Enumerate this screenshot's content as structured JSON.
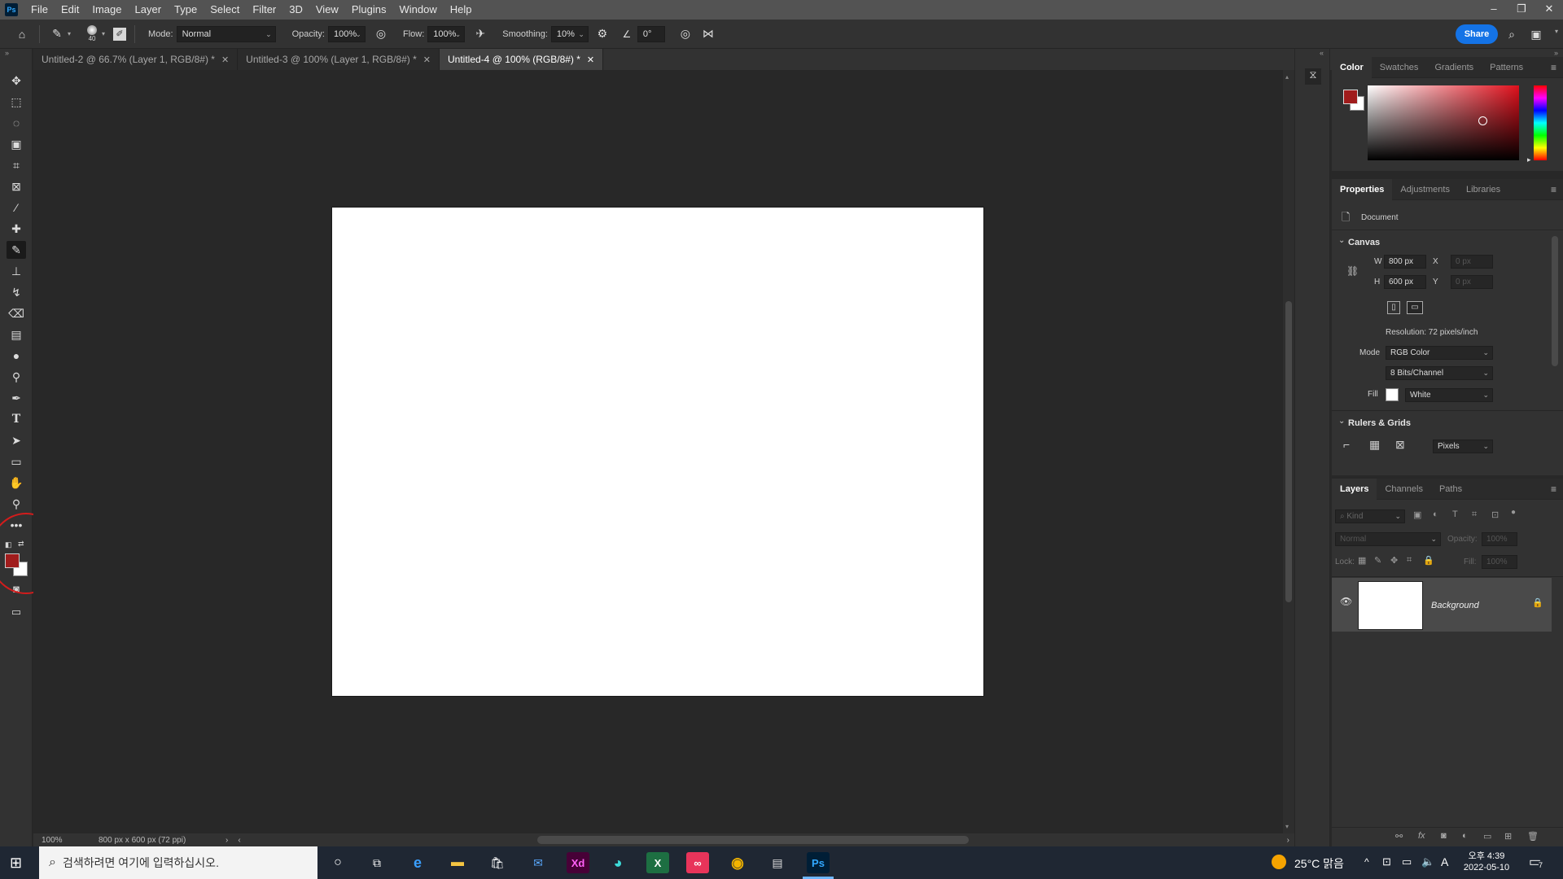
{
  "menubar": {
    "app_icon": "Ps",
    "items": [
      "File",
      "Edit",
      "Image",
      "Layer",
      "Type",
      "Select",
      "Filter",
      "3D",
      "View",
      "Plugins",
      "Window",
      "Help"
    ],
    "window_controls": [
      "–",
      "❐",
      "✕"
    ]
  },
  "options": {
    "brush_size": "40",
    "mode_label": "Mode:",
    "mode_value": "Normal",
    "opacity_label": "Opacity:",
    "opacity_value": "100%",
    "flow_label": "Flow:",
    "flow_value": "100%",
    "smoothing_label": "Smoothing:",
    "smoothing_value": "10%",
    "angle_value": "0°",
    "share_label": "Share"
  },
  "tabs": [
    {
      "label": "Untitled-2 @ 66.7% (Layer 1, RGB/8#) *"
    },
    {
      "label": "Untitled-3 @ 100% (Layer 1, RGB/8#) *"
    },
    {
      "label": "Untitled-4 @ 100% (RGB/8#) *"
    }
  ],
  "status": {
    "zoom": "100%",
    "doc_size": "800 px x 600 px (72 ppi)"
  },
  "color_panel": {
    "tabs": [
      "Color",
      "Swatches",
      "Gradients",
      "Patterns"
    ],
    "foreground": "#a01c1c",
    "background": "#ffffff"
  },
  "properties_panel": {
    "tabs": [
      "Properties",
      "Adjustments",
      "Libraries"
    ],
    "doc_label": "Document",
    "canvas_title": "Canvas",
    "w_label": "W",
    "w_value": "800 px",
    "h_label": "H",
    "h_value": "600 px",
    "x_label": "X",
    "x_value": "0 px",
    "y_label": "Y",
    "y_value": "0 px",
    "resolution": "Resolution: 72 pixels/inch",
    "mode_label": "Mode",
    "mode_value": "RGB Color",
    "bits_value": "8 Bits/Channel",
    "fill_label": "Fill",
    "fill_value": "White",
    "rulers_title": "Rulers & Grids",
    "units_value": "Pixels"
  },
  "layers_panel": {
    "tabs": [
      "Layers",
      "Channels",
      "Paths"
    ],
    "kind_placeholder": "Kind",
    "blend_mode": "Normal",
    "opacity_label": "Opacity:",
    "opacity_value": "100%",
    "lock_label": "Lock:",
    "fill_label": "Fill:",
    "fill_value": "100%",
    "layer_name": "Background"
  },
  "taskbar": {
    "search_placeholder": "검색하려면 여기에 입력하십시오.",
    "weather": "25°C 맑음",
    "time": "오후 4:39",
    "date": "2022-05-10",
    "notification_count": "7",
    "ime": "A"
  }
}
